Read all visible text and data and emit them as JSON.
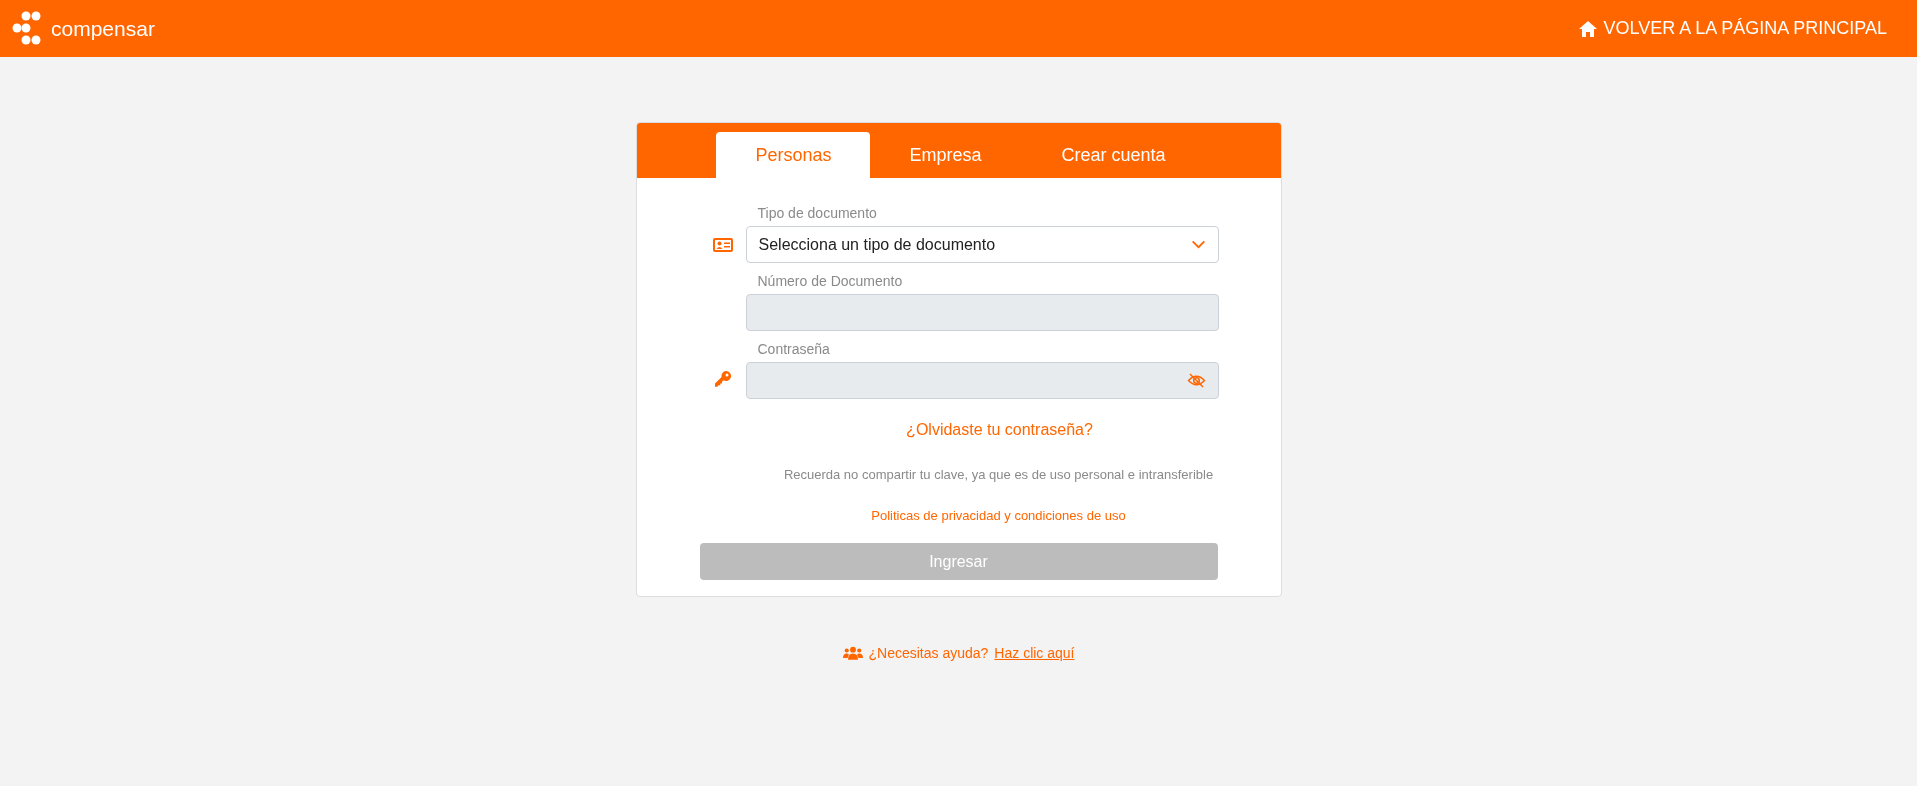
{
  "header": {
    "logo_text": "compensar",
    "home_link": "VOLVER A LA PÁGINA PRINCIPAL"
  },
  "tabs": [
    {
      "label": "Personas",
      "selected": true
    },
    {
      "label": "Empresa",
      "selected": false
    },
    {
      "label": "Crear cuenta",
      "selected": false
    }
  ],
  "fields": [
    {
      "kind": "select",
      "label": "Tipo de documento",
      "value": "Selecciona un tipo de documento",
      "disabled": false
    },
    {
      "kind": "text",
      "label": "Número de Documento",
      "disabled": true
    },
    {
      "kind": "password",
      "label": "Contraseña",
      "disabled": true
    }
  ],
  "forgot_link": "¿Olvidaste tu contraseña?",
  "note": "Recuerda no compartir tu clave, ya que es de uso personal e intransferible",
  "privacy_link": "Politicas de privacidad y condiciones de uso",
  "submit": {
    "label": "Ingresar",
    "disabled": true
  },
  "help": {
    "text": "¿Necesitas ayuda?",
    "link": "Haz clic aquí"
  }
}
